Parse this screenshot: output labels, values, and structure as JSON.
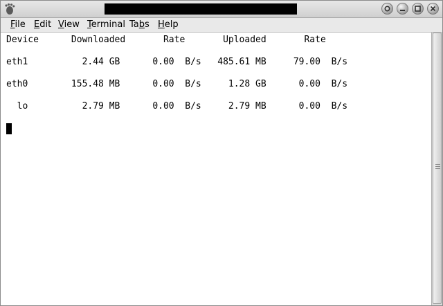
{
  "window": {
    "title": ""
  },
  "menu": {
    "items": [
      {
        "label": "File",
        "accel": "F",
        "rest": "ile"
      },
      {
        "label": "Edit",
        "accel": "E",
        "rest": "dit"
      },
      {
        "label": "View",
        "accel": "V",
        "rest": "iew"
      },
      {
        "label": "Terminal",
        "accel": "T",
        "rest": "erminal"
      },
      {
        "label": "Tabs",
        "pre": "Ta",
        "accel": "b",
        "rest": "s"
      },
      {
        "label": "Help",
        "accel": "H",
        "rest": "elp"
      }
    ]
  },
  "terminal": {
    "lines": [
      "Device      Downloaded       Rate       Uploaded       Rate",
      "",
      "eth1          2.44 GB      0.00  B/s   485.61 MB     79.00  B/s",
      "",
      "eth0        155.48 MB      0.00  B/s     1.28 GB      0.00  B/s",
      "",
      "  lo          2.79 MB      0.00  B/s     2.79 MB      0.00  B/s"
    ]
  },
  "icons": {
    "app": "gnome-foot-icon",
    "buttons": [
      "menu-icon",
      "minimize-icon",
      "maximize-icon",
      "close-icon"
    ]
  }
}
